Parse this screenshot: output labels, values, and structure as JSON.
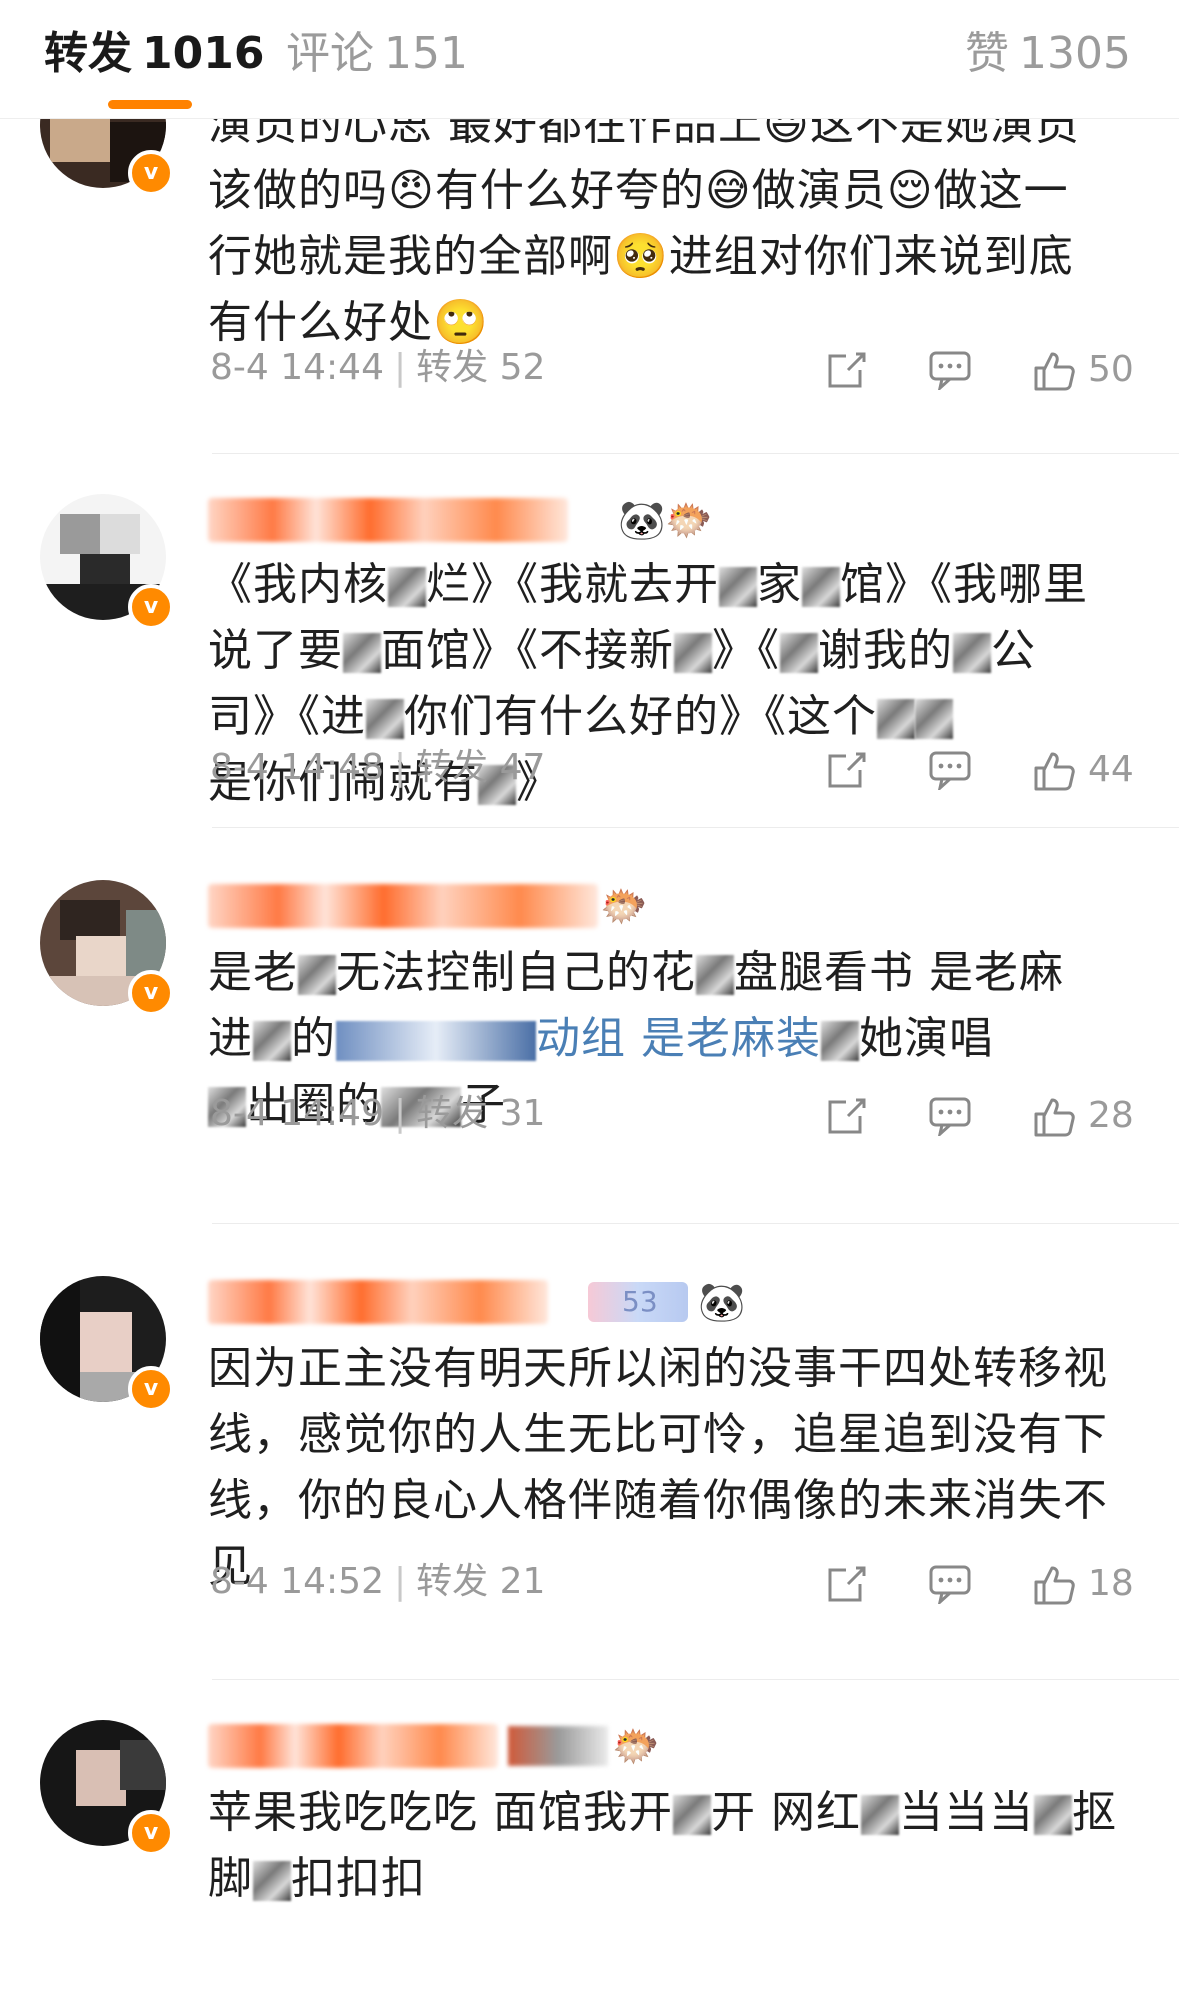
{
  "tabs": {
    "repost_label": "转发",
    "repost_count": "1016",
    "comment_label": "评论",
    "comment_count": "151",
    "like_label": "赞",
    "like_count": "1305"
  },
  "accent_color": "#ff8200",
  "repost_word": "转发",
  "items": [
    {
      "lines": [
        "演员的心思 最好都在作品上😃这不是她演员",
        "该做的吗😠有什么好夸的😅做演员😌做这一",
        "行她就是我的全部啊🥺进组对你们来说到底",
        "有什么好处🙄"
      ],
      "time": "8-4 14:44",
      "repost_label": "转发",
      "repost_count": "52",
      "likes": "50"
    },
    {
      "name_icons": "🐼🐡",
      "lines": [
        "《我内核",
        "烂》《我就去开",
        "家",
        "馆》《我哪里",
        "说了要",
        "面馆》《不接新",
        "》《",
        "谢我的",
        "公",
        "司》《进",
        "你们有什么好的》《这个",
        "是你们闹就有",
        "》"
      ],
      "time": "8-4 14:48",
      "repost_label": "转发",
      "repost_count": "47",
      "likes": "44"
    },
    {
      "name_icons": "🐡",
      "lines": [
        "是老",
        "无法控制自己的花",
        "盘腿看书 是老麻",
        "进",
        "的",
        "动组 是老麻装",
        "她演唱",
        "出圈的",
        "子"
      ],
      "time": "8-4 14:49",
      "repost_label": "转发",
      "repost_count": "31",
      "likes": "28"
    },
    {
      "name_icons": "🐼",
      "badge_text": "53",
      "lines": [
        "因为正主没有明天所以闲的没事干四处转移视",
        "线，感觉你的人生无比可怜，追星追到没有下",
        "线，你的良心人格伴随着你偶像的未来消失不",
        "见"
      ],
      "time": "8-4 14:52",
      "repost_label": "转发",
      "repost_count": "21",
      "likes": "18"
    },
    {
      "name_icons": "🐡",
      "lines": [
        "苹果我吃吃吃 面馆我开",
        "开 网红",
        "当当当",
        "抠",
        "脚",
        "扣扣扣"
      ],
      "time": "",
      "repost_label": "",
      "repost_count": "",
      "likes": ""
    }
  ]
}
